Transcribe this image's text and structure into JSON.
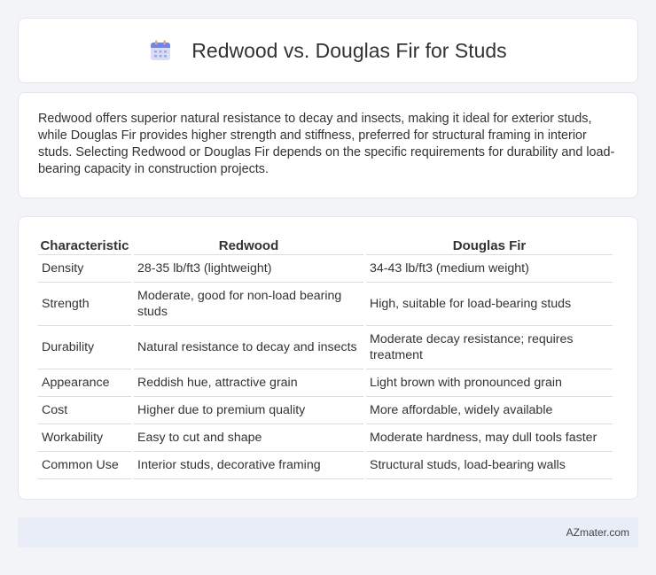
{
  "header": {
    "title": "Redwood vs. Douglas Fir for Studs",
    "icon": "calendar-icon"
  },
  "intro": {
    "text": "Redwood offers superior natural resistance to decay and insects, making it ideal for exterior studs, while Douglas Fir provides higher strength and stiffness, preferred for structural framing in interior studs. Selecting Redwood or Douglas Fir depends on the specific requirements for durability and load-bearing capacity in construction projects."
  },
  "table": {
    "headers": [
      "Characteristic",
      "Redwood",
      "Douglas Fir"
    ],
    "rows": [
      [
        "Density",
        "28-35 lb/ft3 (lightweight)",
        "34-43 lb/ft3 (medium weight)"
      ],
      [
        "Strength",
        "Moderate, good for non-load bearing studs",
        "High, suitable for load-bearing studs"
      ],
      [
        "Durability",
        "Natural resistance to decay and insects",
        "Moderate decay resistance; requires treatment"
      ],
      [
        "Appearance",
        "Reddish hue, attractive grain",
        "Light brown with pronounced grain"
      ],
      [
        "Cost",
        "Higher due to premium quality",
        "More affordable, widely available"
      ],
      [
        "Workability",
        "Easy to cut and shape",
        "Moderate hardness, may dull tools faster"
      ],
      [
        "Common Use",
        "Interior studs, decorative framing",
        "Structural studs, load-bearing walls"
      ]
    ]
  },
  "footer": {
    "brand": "AZmater.com"
  }
}
